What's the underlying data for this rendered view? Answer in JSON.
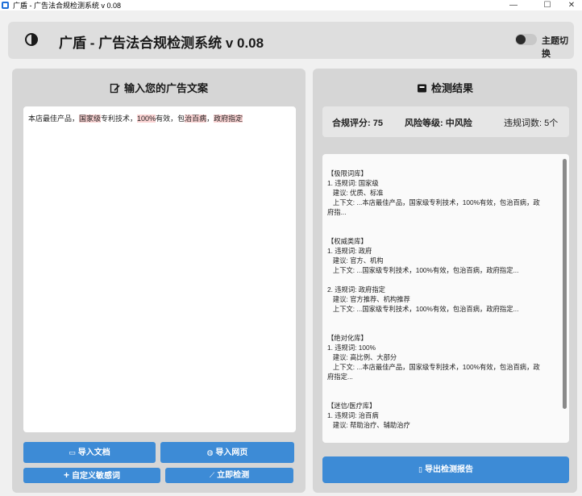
{
  "window": {
    "title": "广盾 - 广告法合规检测系统 v 0.08",
    "minimize": "—",
    "maximize": "☐",
    "close": "✕"
  },
  "header": {
    "title": "广盾 - 广告法合规检测系统 v 0.08",
    "theme_toggle_label": "主题切换",
    "theme_toggle_on": false
  },
  "input_panel": {
    "title": "输入您的广告文案",
    "text_segments": [
      {
        "text": "本店最佳产品，",
        "flagged": false
      },
      {
        "text": "国家级",
        "flagged": true
      },
      {
        "text": "专利技术，",
        "flagged": false
      },
      {
        "text": "100%",
        "flagged": true
      },
      {
        "text": "有效，包",
        "flagged": false
      },
      {
        "text": "治百病",
        "flagged": true
      },
      {
        "text": "，",
        "flagged": false
      },
      {
        "text": "政府指定",
        "flagged": true
      }
    ],
    "buttons": {
      "import_doc": "导入文档",
      "import_web": "导入网页",
      "custom_words": "自定义敏感词",
      "detect_now": "立即检测"
    }
  },
  "result_panel": {
    "title": "检测结果",
    "score_label": "合规评分: 75",
    "risk_label": "风险等级: 中风险",
    "count_label": "违规词数: 5个",
    "results_text": [
      "【极限词库】",
      "1. 违规词: 国家级",
      "   建议: 优质、标准",
      "   上下文: ...本店最佳产品，国家级专利技术，100%有效，包治百病，政",
      "府指...",
      "",
      "【权威类库】",
      "1. 违规词: 政府",
      "   建议: 官方、机构",
      "   上下文: ...国家级专利技术，100%有效，包治百病，政府指定...",
      "",
      "2. 违规词: 政府指定",
      "   建议: 官方推荐、机构推荐",
      "   上下文: ...国家级专利技术，100%有效，包治百病，政府指定...",
      "",
      "【绝对化库】",
      "1. 违规词: 100%",
      "   建议: 高比例、大部分",
      "   上下文: ...本店最佳产品，国家级专利技术，100%有效，包治百病，政",
      "府指定...",
      "",
      "【迷信/医疗库】",
      "1. 违规词: 治百病",
      "   建议: 帮助治疗、辅助治疗"
    ],
    "export_button": "导出检测报告"
  },
  "colors": {
    "accent": "#3d8bd6",
    "highlight": "#fbd4d4",
    "panel_bg": "#d6d6d6"
  }
}
